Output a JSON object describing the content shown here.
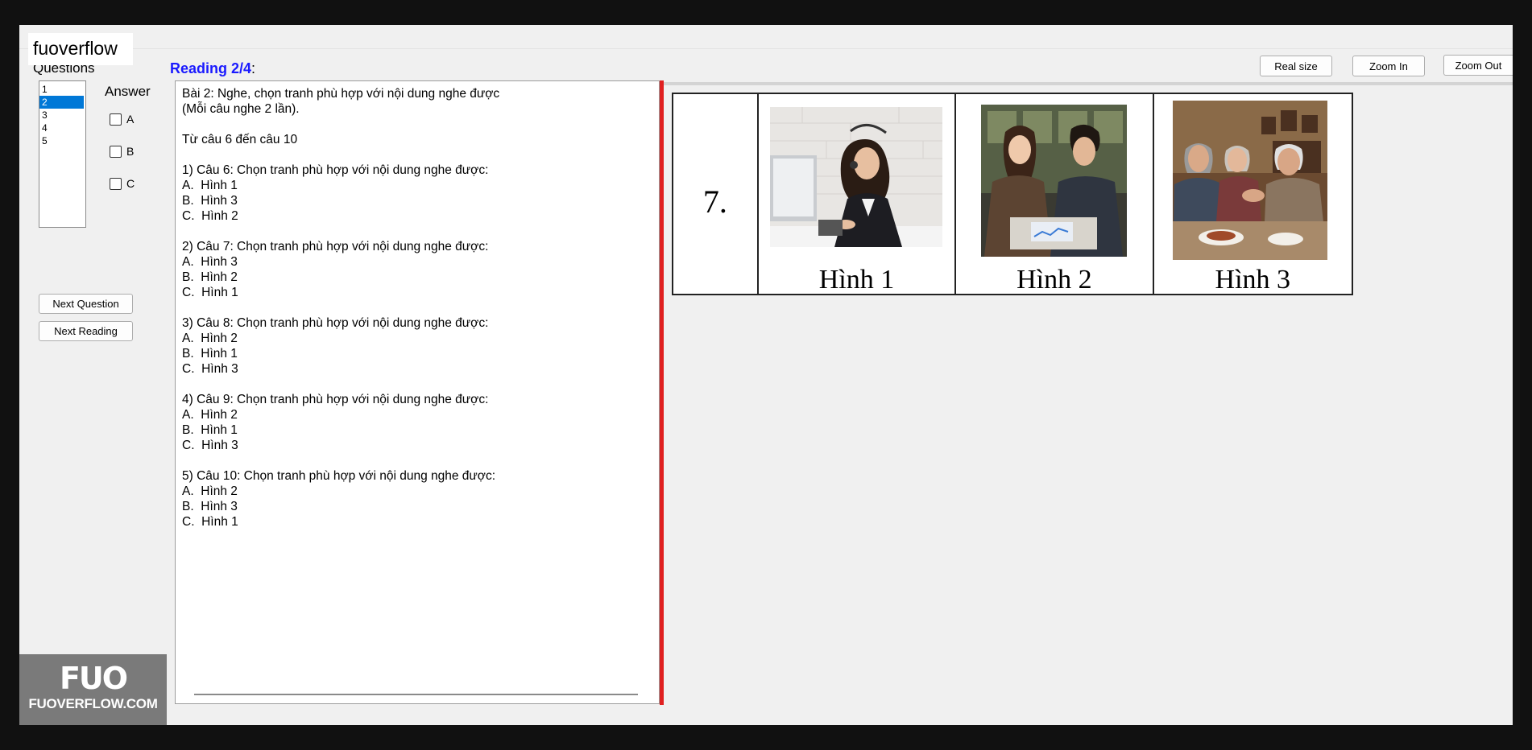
{
  "watermark": {
    "top_text": "fuoverflow",
    "logo_text": "FUO",
    "site": "FUOVERFLOW.COM"
  },
  "sidebar": {
    "questions_label": "Questions",
    "question_items": [
      "1",
      "2",
      "3",
      "4",
      "5"
    ],
    "selected_question": "2",
    "answer_label": "Answer",
    "options": [
      {
        "label": "A",
        "checked": false
      },
      {
        "label": "B",
        "checked": false
      },
      {
        "label": "C",
        "checked": false
      }
    ],
    "next_question_label": "Next Question",
    "next_reading_label": "Next Reading"
  },
  "reading": {
    "title": "Reading 2/4",
    "title_suffix": ":",
    "lines": [
      "Bài 2: Nghe, chọn tranh phù hợp với nội dung nghe được",
      "(Mỗi câu nghe 2 lần).",
      "",
      "Từ câu 6 đến câu 10",
      "",
      "1) Câu 6: Chọn tranh phù hợp với nội dung nghe được:",
      "A.  Hình 1",
      "B.  Hình 3",
      "C.  Hình 2",
      "",
      "2) Câu 7: Chọn tranh phù hợp với nội dung nghe được:",
      "A.  Hình 3",
      "B.  Hình 2",
      "C.  Hình 1",
      "",
      "3) Câu 8: Chọn tranh phù hợp với nội dung nghe được:",
      "A.  Hình 2",
      "B.  Hình 1",
      "C.  Hình 3",
      "",
      "4) Câu 9: Chọn tranh phù hợp với nội dung nghe được:",
      "A.  Hình 2",
      "B.  Hình 1",
      "C.  Hình 3",
      "",
      "5) Câu 10: Chọn tranh phù hợp với nội dung nghe được:",
      "A.  Hình 2",
      "B.  Hình 3",
      "C.  Hình 1"
    ]
  },
  "toolbar": {
    "real_size": "Real size",
    "zoom_in": "Zoom In",
    "zoom_out": "Zoom Out"
  },
  "figure": {
    "number": "7.",
    "captions": [
      "Hình 1",
      "Hình 2",
      "Hình 3"
    ]
  },
  "colors": {
    "accent_title": "#1a1aff",
    "splitter": "#e02020",
    "selection": "#0078d7"
  }
}
